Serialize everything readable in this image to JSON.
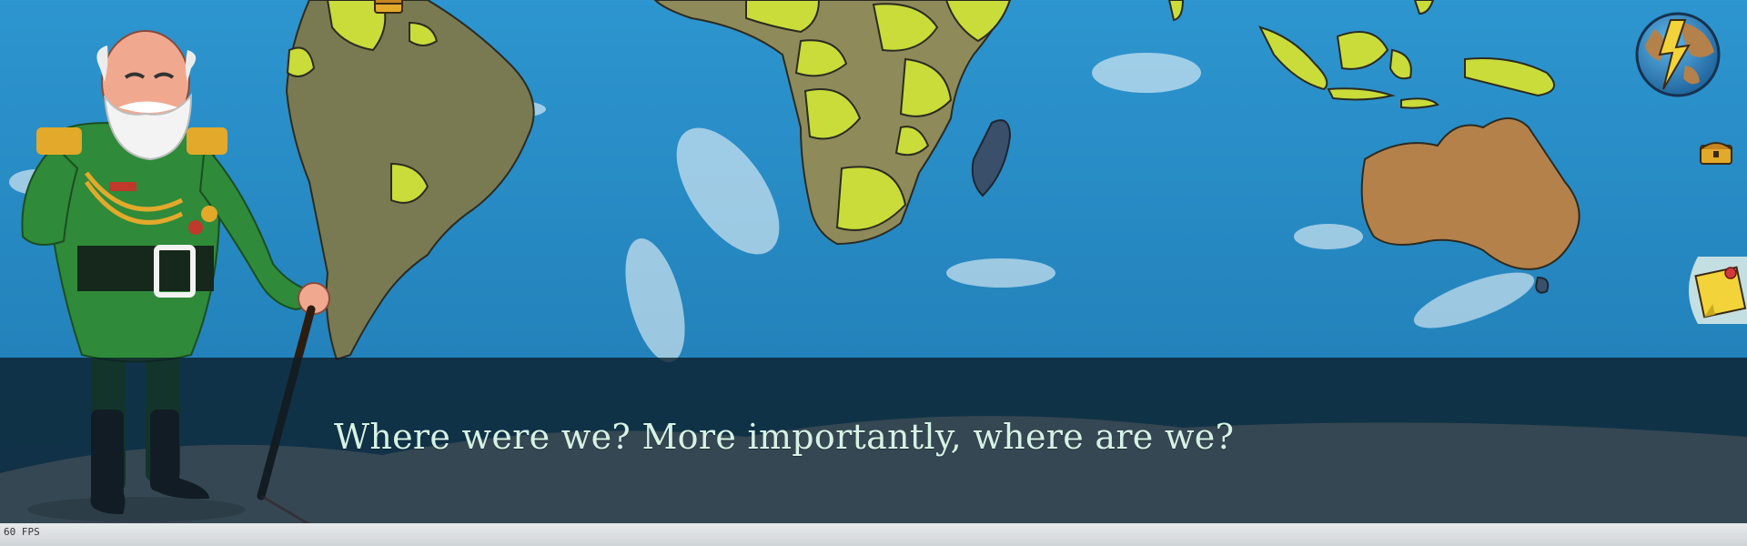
{
  "dialog": {
    "text": "Where were we? More importantly, where are we?"
  },
  "hud": {
    "fps_label": "60 FPS"
  },
  "icons": {
    "globe": "globe-icon",
    "chest": "treasure-chest-icon",
    "note": "sticky-note-icon"
  },
  "colors": {
    "ocean": "#2a8fc9",
    "highlight_country": "#c9dc3a",
    "dialog_text": "#d6f2e4",
    "uniform_green": "#2f8a3a"
  }
}
